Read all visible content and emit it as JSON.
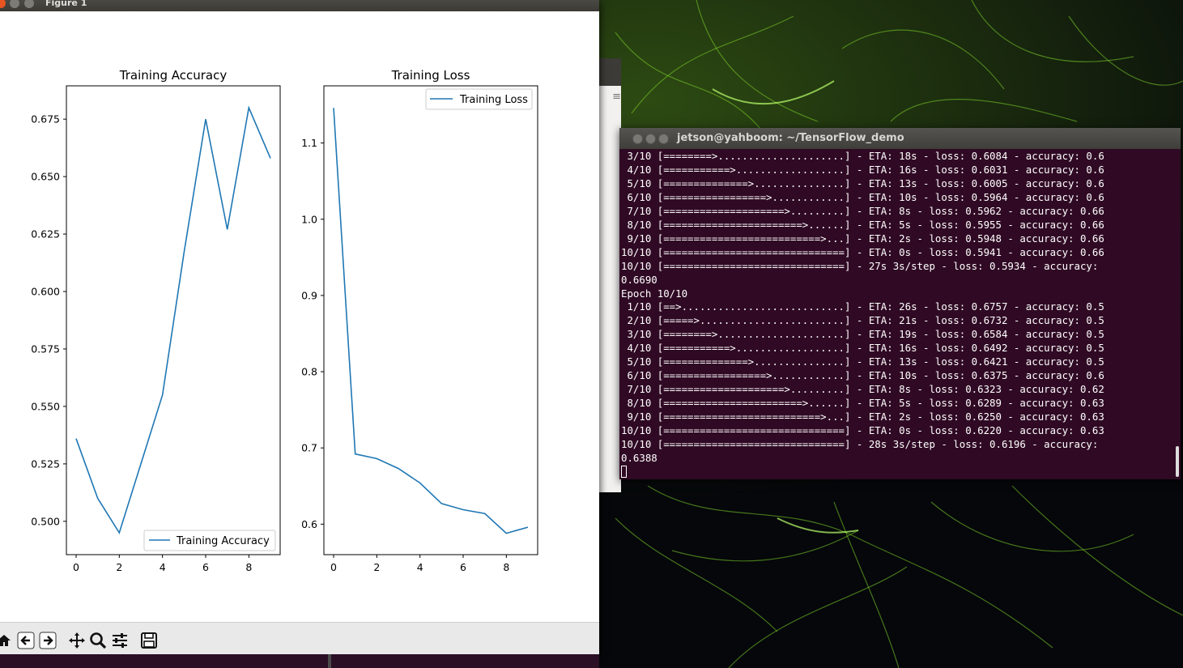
{
  "figure_window": {
    "title": "Figure 1",
    "toolbar": {
      "home": "home-icon",
      "back": "arrow-left-icon",
      "forward": "arrow-right-icon",
      "pan": "move-icon",
      "zoom": "magnifier-icon",
      "configure": "sliders-icon",
      "save": "floppy-disk-icon"
    }
  },
  "chart_data": [
    {
      "type": "line",
      "title": "Training Accuracy",
      "x": [
        0,
        1,
        2,
        3,
        4,
        5,
        6,
        7,
        8,
        9
      ],
      "series": [
        {
          "name": "Training Accuracy",
          "values": [
            0.536,
            0.51,
            0.495,
            0.525,
            0.555,
            0.617,
            0.675,
            0.627,
            0.68,
            0.658
          ]
        }
      ],
      "xlim": [
        -0.45,
        9.45
      ],
      "ylim": [
        0.4855,
        0.6895
      ],
      "xticks": [
        0,
        2,
        4,
        6,
        8
      ],
      "xtick_labels": [
        "0",
        "2",
        "4",
        "6",
        "8"
      ],
      "yticks": [
        0.5,
        0.525,
        0.55,
        0.575,
        0.6,
        0.625,
        0.65,
        0.675
      ],
      "ytick_labels": [
        "0.500",
        "0.525",
        "0.550",
        "0.575",
        "0.600",
        "0.625",
        "0.650",
        "0.675"
      ],
      "legend_position": "lower-right",
      "color": "#1f77b4"
    },
    {
      "type": "line",
      "title": "Training Loss",
      "x": [
        0,
        1,
        2,
        3,
        4,
        5,
        6,
        7,
        8,
        9
      ],
      "series": [
        {
          "name": "Training Loss",
          "values": [
            1.146,
            0.692,
            0.686,
            0.673,
            0.654,
            0.627,
            0.619,
            0.614,
            0.588,
            0.596
          ]
        }
      ],
      "xlim": [
        -0.45,
        9.45
      ],
      "ylim": [
        0.56,
        1.175
      ],
      "xticks": [
        0,
        2,
        4,
        6,
        8
      ],
      "xtick_labels": [
        "0",
        "2",
        "4",
        "6",
        "8"
      ],
      "yticks": [
        0.6,
        0.7,
        0.8,
        0.9,
        1.0,
        1.1
      ],
      "ytick_labels": [
        "0.6",
        "0.7",
        "0.8",
        "0.9",
        "1.0",
        "1.1"
      ],
      "legend_position": "upper-right",
      "color": "#1f77b4"
    }
  ],
  "terminal": {
    "title": "jetson@yahboom: ~/TensorFlow_demo",
    "lines": [
      " 3/10 [========>.....................] - ETA: 18s - loss: 0.6084 - accuracy: 0.6",
      " 4/10 [===========>..................] - ETA: 16s - loss: 0.6031 - accuracy: 0.6",
      " 5/10 [==============>...............] - ETA: 13s - loss: 0.6005 - accuracy: 0.6",
      " 6/10 [=================>............] - ETA: 10s - loss: 0.5964 - accuracy: 0.6",
      " 7/10 [====================>.........] - ETA: 8s - loss: 0.5962 - accuracy: 0.66",
      " 8/10 [=======================>......] - ETA: 5s - loss: 0.5955 - accuracy: 0.66",
      " 9/10 [==========================>...] - ETA: 2s - loss: 0.5948 - accuracy: 0.66",
      "10/10 [==============================] - ETA: 0s - loss: 0.5941 - accuracy: 0.66",
      "10/10 [==============================] - 27s 3s/step - loss: 0.5934 - accuracy:",
      "0.6690",
      "Epoch 10/10",
      " 1/10 [==>...........................] - ETA: 26s - loss: 0.6757 - accuracy: 0.5",
      " 2/10 [=====>........................] - ETA: 21s - loss: 0.6732 - accuracy: 0.5",
      " 3/10 [========>.....................] - ETA: 19s - loss: 0.6584 - accuracy: 0.5",
      " 4/10 [===========>..................] - ETA: 16s - loss: 0.6492 - accuracy: 0.5",
      " 5/10 [==============>...............] - ETA: 13s - loss: 0.6421 - accuracy: 0.5",
      " 6/10 [=================>............] - ETA: 10s - loss: 0.6375 - accuracy: 0.6",
      " 7/10 [====================>.........] - ETA: 8s - loss: 0.6323 - accuracy: 0.62",
      " 8/10 [=======================>......] - ETA: 5s - loss: 0.6289 - accuracy: 0.63",
      " 9/10 [==========================>...] - ETA: 2s - loss: 0.6250 - accuracy: 0.63",
      "10/10 [==============================] - ETA: 0s - loss: 0.6220 - accuracy: 0.63",
      "10/10 [==============================] - 28s 3s/step - loss: 0.6196 - accuracy:",
      "0.6388"
    ]
  },
  "colors": {
    "terminal_bg": "#300a24",
    "plot_line": "#1f77b4",
    "titlebar": "#3c3b37",
    "close_button": "#e95420"
  }
}
